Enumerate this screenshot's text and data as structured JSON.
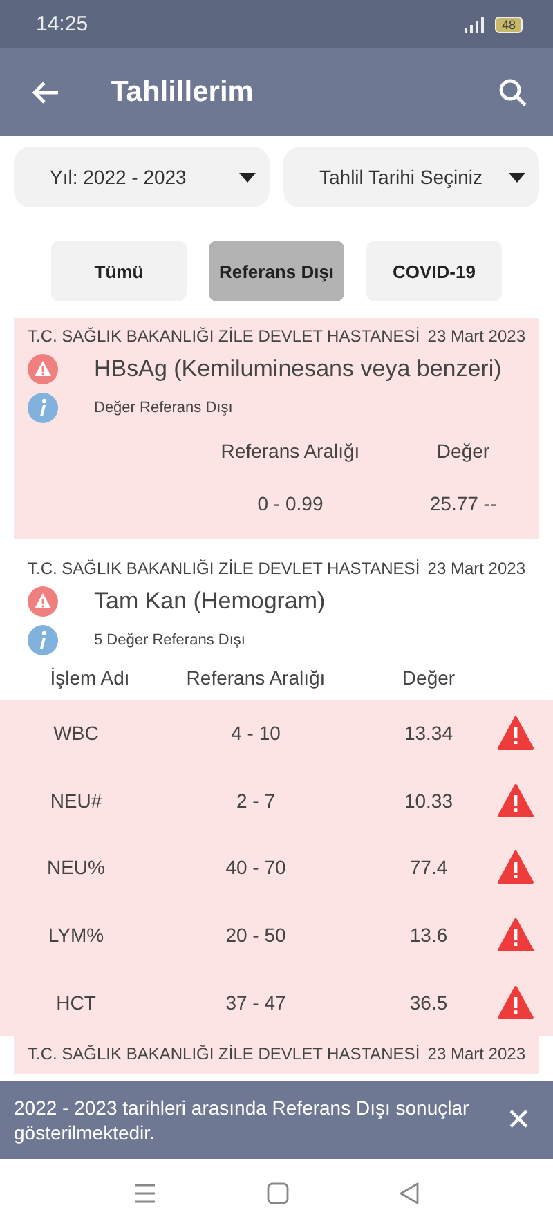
{
  "status_bar": {
    "time": "14:25",
    "battery": "48"
  },
  "app_bar": {
    "title": "Tahlillerim"
  },
  "filters": [
    {
      "label": "Yıl: 2022 - 2023"
    },
    {
      "label": "Tahlil Tarihi Seçiniz"
    }
  ],
  "chips": [
    {
      "label": "Tümü",
      "selected": false
    },
    {
      "label": "Referans Dışı",
      "selected": true
    },
    {
      "label": "COVID-19",
      "selected": false
    }
  ],
  "results": [
    {
      "kind": "single",
      "hospital": "T.C. SAĞLIK BAKANLIĞI ZİLE DEVLET HASTANESİ",
      "date": "23 Mart 2023",
      "test": "HBsAg (Kemiluminesans veya benzeri)",
      "note": "Değer Referans Dışı",
      "columns": [
        "Referans Aralığı",
        "Değer"
      ],
      "rows": [
        {
          "range": "0 - 0.99",
          "value": "25.77 --"
        }
      ]
    },
    {
      "kind": "panel",
      "hospital": "T.C. SAĞLIK BAKANLIĞI ZİLE DEVLET HASTANESİ",
      "date": "23 Mart 2023",
      "test": "Tam Kan (Hemogram)",
      "note": "5 Değer Referans Dışı",
      "columns": [
        "İşlem Adı",
        "Referans Aralığı",
        "Değer"
      ],
      "rows": [
        {
          "name": "WBC",
          "range": "4 - 10",
          "value": "13.34",
          "flagged": true
        },
        {
          "name": "NEU#",
          "range": "2 - 7",
          "value": "10.33",
          "flagged": true
        },
        {
          "name": "NEU%",
          "range": "40 - 70",
          "value": "77.4",
          "flagged": true
        },
        {
          "name": "LYM%",
          "range": "20 - 50",
          "value": "13.6",
          "flagged": true
        },
        {
          "name": "HCT",
          "range": "37 - 47",
          "value": "36.5",
          "flagged": true
        }
      ]
    },
    {
      "kind": "single",
      "hospital": "T.C. SAĞLIK BAKANLIĞI ZİLE DEVLET HASTANESİ",
      "date": "23 Mart 2023"
    }
  ],
  "snackbar": {
    "message": "2022 - 2023 tarihleri arasında Referans Dışı sonuçlar gösterilmektedir.",
    "close": "✕"
  }
}
